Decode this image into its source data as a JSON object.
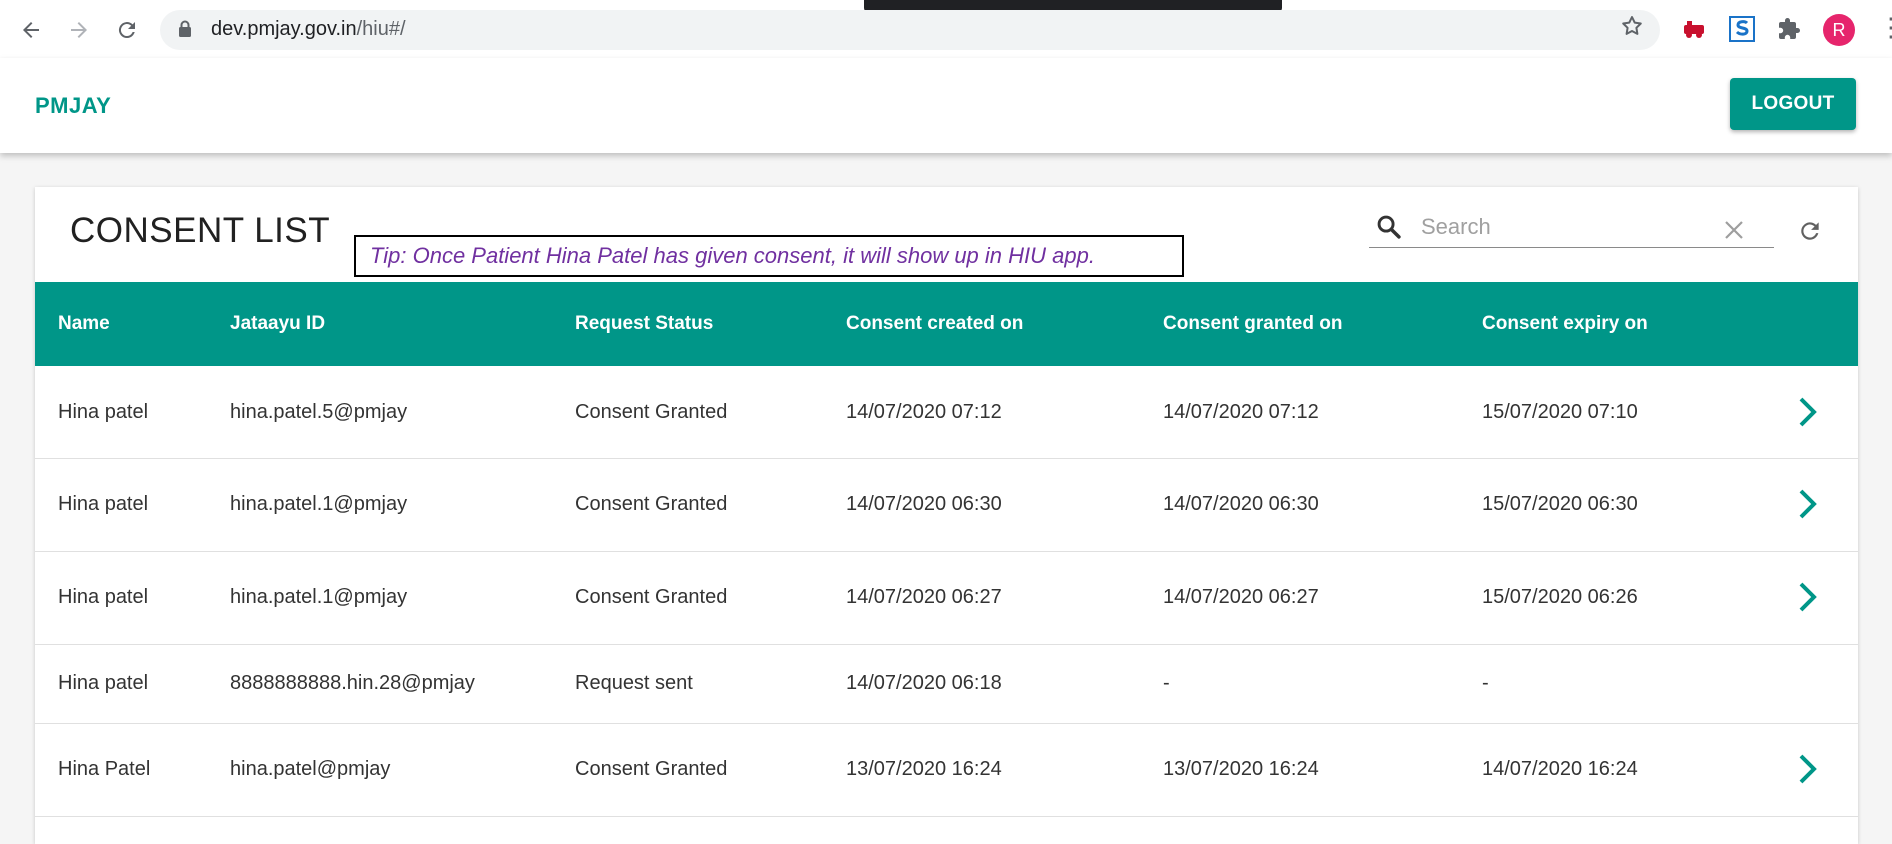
{
  "browser": {
    "url_host": "dev.pmjay.gov.in",
    "url_path": "/hiu#/",
    "avatar_letter": "R",
    "icons": [
      "back-icon",
      "forward-icon",
      "reload-icon",
      "lock-icon",
      "star-icon",
      "extension-icons",
      "avatar",
      "more-icon"
    ]
  },
  "app": {
    "brand": "PMJAY",
    "logout_label": "LOGOUT",
    "accent_color": "#009688"
  },
  "consent": {
    "title": "CONSENT LIST",
    "tip": "Tip: Once Patient Hina Patel has given consent, it will show up in HIU app.",
    "search_placeholder": "Search",
    "columns": [
      "Name",
      "Jataayu ID",
      "Request Status",
      "Consent created on",
      "Consent granted on",
      "Consent expiry on"
    ],
    "rows": [
      {
        "name": "Hina patel",
        "id": "hina.patel.5@pmjay",
        "status": "Consent Granted",
        "created": "14/07/2020 07:12",
        "granted": "14/07/2020 07:12",
        "expiry": "15/07/2020 07:10",
        "has_action": true
      },
      {
        "name": "Hina patel",
        "id": "hina.patel.1@pmjay",
        "status": "Consent Granted",
        "created": "14/07/2020 06:30",
        "granted": "14/07/2020 06:30",
        "expiry": "15/07/2020 06:30",
        "has_action": true
      },
      {
        "name": "Hina patel",
        "id": "hina.patel.1@pmjay",
        "status": "Consent Granted",
        "created": "14/07/2020 06:27",
        "granted": "14/07/2020 06:27",
        "expiry": "15/07/2020 06:26",
        "has_action": true
      },
      {
        "name": "Hina patel",
        "id": "8888888888.hin.28@pmjay",
        "status": "Request sent",
        "created": "14/07/2020 06:18",
        "granted": "-",
        "expiry": "-",
        "has_action": false
      },
      {
        "name": "Hina Patel",
        "id": "hina.patel@pmjay",
        "status": "Consent Granted",
        "created": "13/07/2020 16:24",
        "granted": "13/07/2020 16:24",
        "expiry": "14/07/2020 16:24",
        "has_action": true
      }
    ]
  }
}
